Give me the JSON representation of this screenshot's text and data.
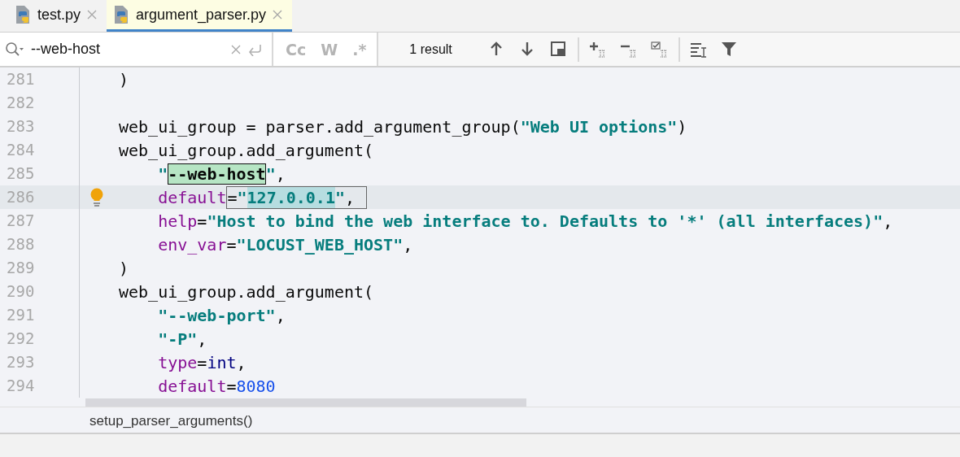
{
  "tabs": [
    {
      "label": "test.py",
      "selected": false
    },
    {
      "label": "argument_parser.py",
      "selected": true
    }
  ],
  "find_bar": {
    "query": "--web-host",
    "options": [
      {
        "label": "Cc",
        "on": false
      },
      {
        "label": "W",
        "on": false
      },
      {
        "label": ".*",
        "on": false
      }
    ],
    "result_count": "1 result"
  },
  "editor": {
    "lines": [
      {
        "number": "281",
        "current": false,
        "tokens": [
          {
            "kind": "text",
            "text": ")"
          }
        ]
      },
      {
        "number": "282",
        "current": false
      },
      {
        "number": "283",
        "current": false,
        "tokens": [
          {
            "kind": "text",
            "text": "web_ui_group = parser.add_argument_group("
          },
          {
            "kind": "string",
            "text": "\"Web UI options\""
          },
          {
            "kind": "text",
            "text": ")"
          }
        ]
      },
      {
        "number": "284",
        "current": false,
        "tokens": [
          {
            "kind": "text",
            "text": "web_ui_group.add_argument("
          }
        ]
      },
      {
        "number": "285",
        "current": false,
        "tokens": [
          {
            "kind": "string",
            "text": "    \""
          },
          {
            "kind": "match",
            "text": "--web-host"
          },
          {
            "kind": "string",
            "text": "\""
          },
          {
            "kind": "text",
            "text": ","
          }
        ]
      },
      {
        "number": "286",
        "current": true,
        "tokens": [
          {
            "kind": "param",
            "text": "    default"
          },
          {
            "kind": "boxed",
            "parts": [
              {
                "kind": "text",
                "text": "="
              },
              {
                "kind": "string",
                "text": "\""
              },
              {
                "kind": "selection",
                "text": "127.0.0.1"
              },
              {
                "kind": "string",
                "text": "\""
              },
              {
                "kind": "text",
                "text": ","
              }
            ]
          }
        ]
      },
      {
        "number": "287",
        "current": false,
        "tokens": [
          {
            "kind": "param",
            "text": "    help"
          },
          {
            "kind": "text",
            "text": "="
          },
          {
            "kind": "string",
            "text": "\"Host to bind the web interface to. Defaults to '*' (all interfaces)\""
          },
          {
            "kind": "text",
            "text": ","
          }
        ]
      },
      {
        "number": "288",
        "current": false,
        "tokens": [
          {
            "kind": "param",
            "text": "    env_var"
          },
          {
            "kind": "text",
            "text": "="
          },
          {
            "kind": "string",
            "text": "\"LOCUST_WEB_HOST\""
          },
          {
            "kind": "text",
            "text": ","
          }
        ]
      },
      {
        "number": "289",
        "current": false,
        "tokens": [
          {
            "kind": "text",
            "text": ")"
          }
        ]
      },
      {
        "number": "290",
        "current": false,
        "tokens": [
          {
            "kind": "text",
            "text": "web_ui_group.add_argument("
          }
        ]
      },
      {
        "number": "291",
        "current": false,
        "tokens": [
          {
            "kind": "string",
            "text": "    \"--web-port\""
          },
          {
            "kind": "text",
            "text": ","
          }
        ]
      },
      {
        "number": "292",
        "current": false,
        "tokens": [
          {
            "kind": "string",
            "text": "    \"-P\""
          },
          {
            "kind": "text",
            "text": ","
          }
        ]
      },
      {
        "number": "293",
        "current": false,
        "tokens": [
          {
            "kind": "param",
            "text": "    type"
          },
          {
            "kind": "text",
            "text": "="
          },
          {
            "kind": "builtin",
            "text": "int"
          },
          {
            "kind": "text",
            "text": ","
          }
        ]
      },
      {
        "number": "294",
        "current": false,
        "tokens": [
          {
            "kind": "param",
            "text": "    default"
          },
          {
            "kind": "text",
            "text": "="
          },
          {
            "kind": "number",
            "text": "8080"
          }
        ]
      }
    ]
  },
  "breadcrumb": "setup_parser_arguments()"
}
